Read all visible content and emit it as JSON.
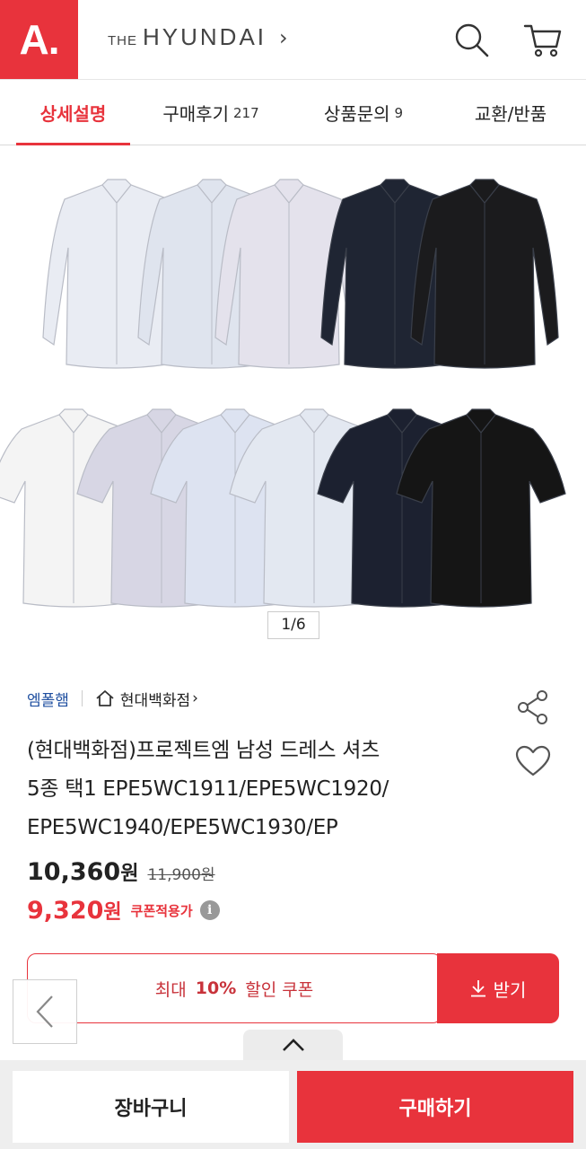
{
  "header": {
    "logo": "A.",
    "brand_prefix": "THE",
    "brand_name": "HYUNDAI",
    "brand_chevron": "›",
    "icons": [
      "search-icon",
      "cart-icon"
    ]
  },
  "tabs": [
    {
      "label": "상세설명",
      "count": "",
      "active": true
    },
    {
      "label": "구매후기",
      "count": "217",
      "active": false
    },
    {
      "label": "상품문의",
      "count": "9",
      "active": false
    },
    {
      "label": "교환/반품",
      "count": "",
      "active": false
    }
  ],
  "gallery": {
    "pager": "1/6",
    "shirt_colors_long": [
      "#e9ecf3",
      "#dfe4ee",
      "#e4e2ec",
      "#1f2533",
      "#1b1b1d"
    ],
    "shirt_colors_short": [
      "#f4f4f4",
      "#d7d6e4",
      "#dde3f1",
      "#e3e8f1",
      "#1c2130",
      "#151515"
    ]
  },
  "product": {
    "seller": "엠폴햄",
    "store": "현대백화점",
    "store_chevron": "›",
    "title_lines": [
      "(현대백화점)프로젝트엠 남성 드레스 셔츠",
      "5종 택1 EPE5WC1911/EPE5WC1920/",
      "EPE5WC1940/EPE5WC1930/EP"
    ],
    "price": "10,360",
    "price_unit": "원",
    "original_price": "11,900원",
    "coupon_price": "9,320",
    "coupon_price_unit": "원",
    "coupon_tag": "쿠폰적용가",
    "info_symbol": "i"
  },
  "coupon": {
    "prefix": "최대",
    "percent": "10%",
    "suffix": "할인 쿠폰",
    "download_label": "받기"
  },
  "bottom": {
    "cart_label": "장바구니",
    "buy_label": "구매하기"
  },
  "colors": {
    "accent": "#e8333c",
    "seller_link": "#1f4fa0"
  }
}
